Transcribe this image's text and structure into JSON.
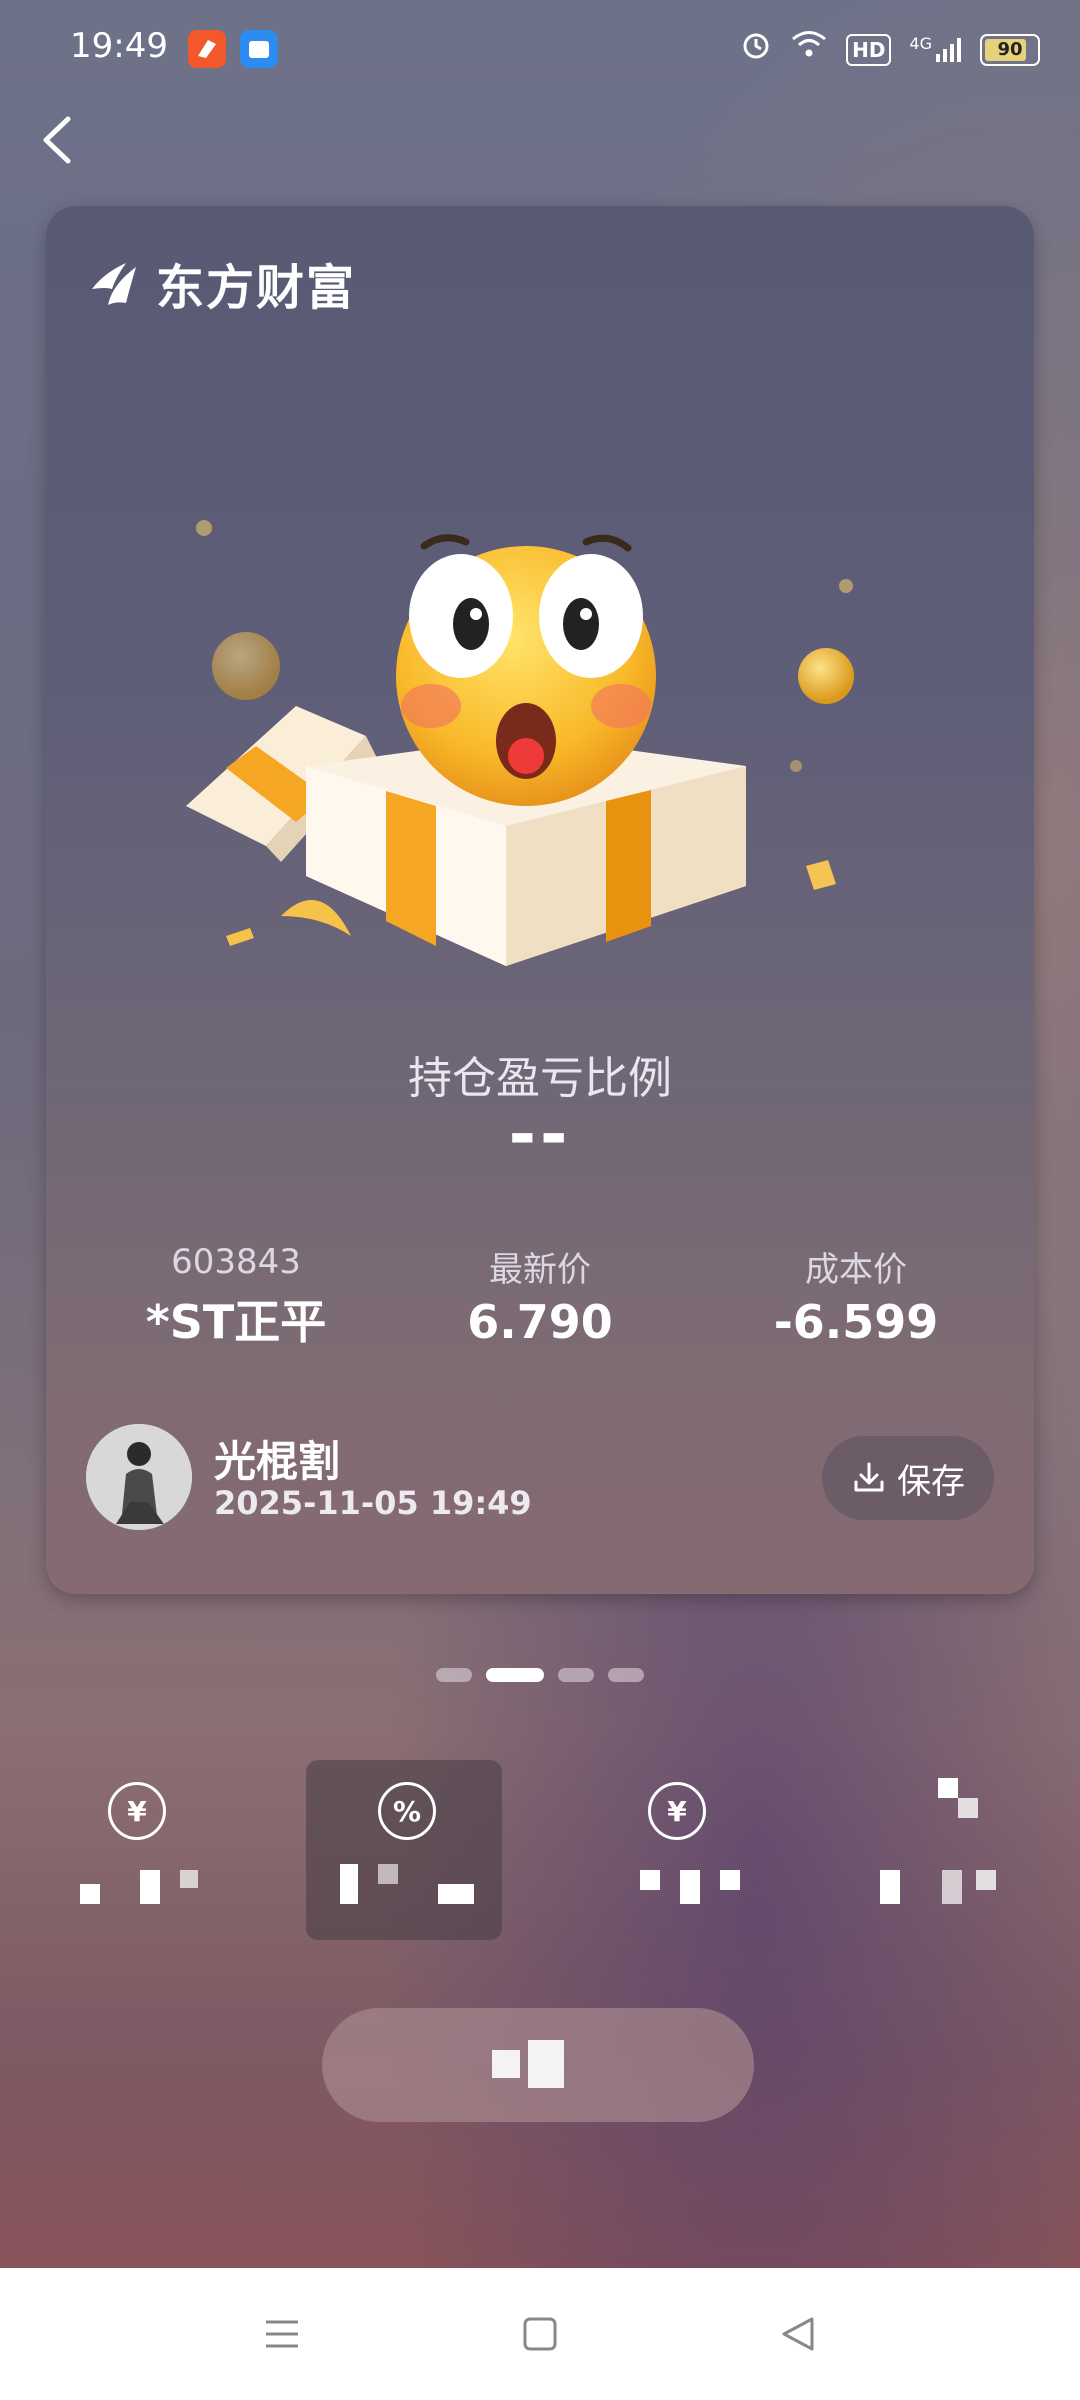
{
  "status_bar": {
    "time": "19:49",
    "network": "4G",
    "hd": "HD",
    "battery": "90",
    "battery_percent": 90
  },
  "card": {
    "brand_name": "东方财富",
    "ratio_title": "持仓盈亏比例",
    "ratio_value": "--",
    "stock": {
      "code": "603843",
      "name": "*ST正平"
    },
    "latest_price": {
      "label": "最新价",
      "value": "6.790"
    },
    "cost_price": {
      "label": "成本价",
      "value": "-6.599"
    },
    "user": {
      "name": "光棍割",
      "time": "2025-11-05 19:49"
    },
    "save_label": "保存"
  },
  "pager": {
    "count": 4,
    "active_index": 1
  },
  "options": [
    {
      "icon": "yuan-circle-icon",
      "symbol": "¥",
      "selected": false
    },
    {
      "icon": "percent-circle-icon",
      "symbol": "%",
      "selected": true
    },
    {
      "icon": "yuan-clock-icon",
      "symbol": "¥",
      "selected": false
    },
    {
      "icon": "mosaic-icon",
      "symbol": "",
      "selected": false
    }
  ],
  "share_label": "",
  "colors": {
    "card_top": "#585a74",
    "card_bottom": "#876a71",
    "app_badge_1": "#f2582a",
    "app_badge_2": "#2d8cf0"
  }
}
